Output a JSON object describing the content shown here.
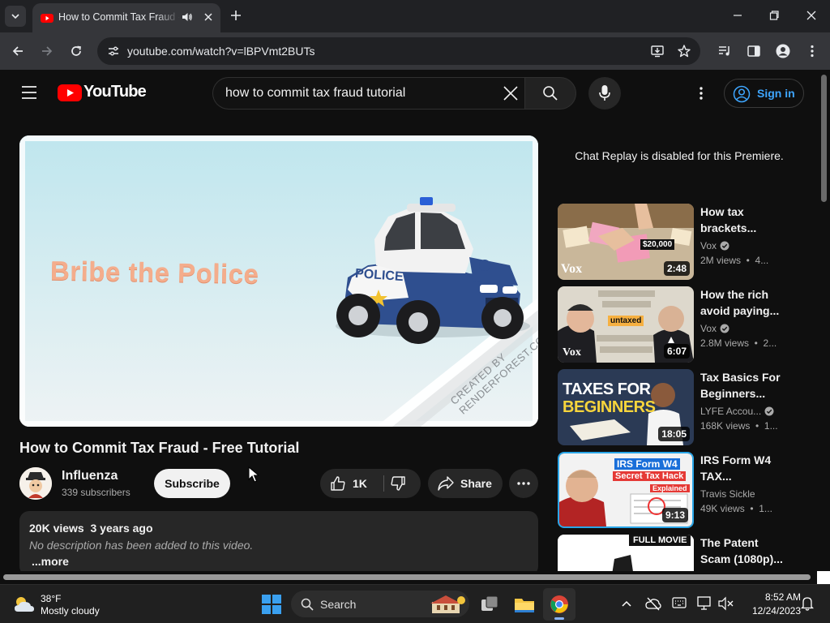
{
  "browser": {
    "tab_title": "How to Commit Tax Fraud - YouTube",
    "url": "youtube.com/watch?v=lBPVmt2BUTs"
  },
  "masthead": {
    "logo_text": "YouTube",
    "search_value": "how to commit tax fraud tutorial",
    "signin_label": "Sign in"
  },
  "player": {
    "caption": "Bribe the Police",
    "car_label": "POLICE",
    "watermark_line1": "CREATED BY",
    "watermark_line2": "RENDERFOREST.COM"
  },
  "video": {
    "title": "How to Commit Tax Fraud - Free Tutorial",
    "channel": "Influenza",
    "subscribers": "339 subscribers",
    "subscribe_label": "Subscribe",
    "likes": "1K",
    "share_label": "Share",
    "stats": "20K views  3 years ago",
    "description": "No description has been added to this video.",
    "more_label": "...more"
  },
  "sidebar": {
    "chat_notice": "Chat Replay is disabled for this Premiere.",
    "recommendations": [
      {
        "title": "How tax brackets...",
        "channel": "Vox",
        "meta": "2M views  •  4...",
        "duration": "2:48",
        "thumb_text": "$20,000",
        "thumb_brand": "Vox"
      },
      {
        "title": "How the rich avoid paying...",
        "channel": "Vox",
        "meta": "2.8M views  •  2...",
        "duration": "6:07",
        "thumb_text": "untaxed",
        "thumb_brand": "Vox"
      },
      {
        "title": "Tax Basics For Beginners...",
        "channel": "LYFE Accou...",
        "meta": "168K views  •  1...",
        "duration": "18:05",
        "thumb_line1": "TAXES FOR",
        "thumb_line2": "BEGINNERS"
      },
      {
        "title": "IRS Form W4 TAX...",
        "channel": "Travis Sickle",
        "meta": "49K views  •  1...",
        "duration": "9:13",
        "thumb_line1": "IRS Form W4",
        "thumb_line2": "Secret Tax Hack",
        "thumb_line3": "Explained"
      },
      {
        "title": "The Patent Scam (1080p)...",
        "thumb_badge": "FULL MOVIE"
      }
    ]
  },
  "taskbar": {
    "temperature": "38°F",
    "weather": "Mostly cloudy",
    "search_label": "Search",
    "time": "8:52 AM",
    "date": "12/24/2023"
  }
}
